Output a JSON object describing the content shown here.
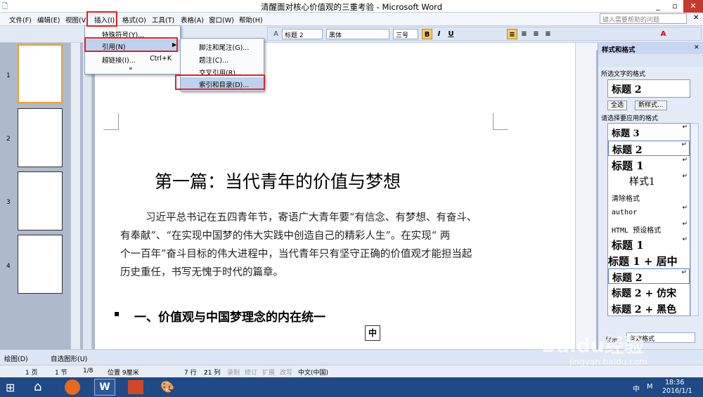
{
  "window": {
    "title": "清醒面对核心价值观的三重考验 - Microsoft Word",
    "min": "_",
    "max": "▫",
    "close": "✕"
  },
  "menu_bar": {
    "items": [
      "文件(F)",
      "编辑(E)",
      "视图(V)",
      "插入(I)",
      "格式(O)",
      "工具(T)",
      "表格(A)",
      "窗口(W)",
      "帮助(H)"
    ],
    "help_placeholder": "键入需要帮助的问题"
  },
  "formatting": {
    "style": "标题 2",
    "font": "黑体",
    "size": "三号",
    "bold": "B",
    "italic": "I",
    "underline": "U"
  },
  "insert_menu": {
    "items": [
      "特殊符号(Y)...",
      "引用(N)",
      "超链接(I)...",
      "Ctrl+K",
      "»"
    ]
  },
  "reference_submenu": {
    "items": [
      "脚注和尾注(G)...",
      "题注(C)...",
      "交叉引用(R)...",
      "索引和目录(D)..."
    ]
  },
  "document": {
    "heading1": "第一篇：当代青年的价值与梦想",
    "paragraph": "习近平总书记在五四青年节，寄语广大青年要“有信念、有梦想、有奋斗、有奉献”、“在实现中国梦的伟大实践中创造自己的精彩人生”。在实现“两个一百年”奋斗目标的伟大进程中，当代青年只有坚守正确的价值观才能担当起历史重任，书写无愧于时代的篇章。",
    "paragraph_lines": [
      "习近平总书记在五四青年节，寄语广大青年要“有信念、有梦想、有奋斗、",
      "有奉献”、“在实现中国梦的伟大实践中创造自己的精彩人生”。在实现“  两",
      "个一百年”奋斗目标的伟大进程中，当代青年只有坚守正确的价值观才能担当起",
      "历史重任，书写无愧于时代的篇章。"
    ],
    "heading2": "一、价值观与中国梦理念的内在统一",
    "ime_indicator": "中"
  },
  "thumbnails": [
    "1",
    "2",
    "3",
    "4"
  ],
  "styles_pane": {
    "title": "样式和格式",
    "selected_label": "所选文字的格式",
    "selected_style": "标题 2",
    "select_all": "全选",
    "new_style": "新样式...",
    "apply_label": "请选择要应用的格式",
    "list": [
      "标题 3",
      "标题 2",
      "标题 1",
      "样式1",
      "清除格式",
      "author",
      "HTML 预设格式",
      "标题 1",
      "标题 1 + 居中",
      "标题 2",
      "标题 2 + 仿宋",
      "标题 2 + 黑色"
    ],
    "show_label": "显示:",
    "show_value": "有效格式"
  },
  "drawing_bar": {
    "draw": "绘图(D)",
    "autoshapes": "自选图形(U)"
  },
  "status": {
    "page": "1 页",
    "section": "1 节",
    "pages": "1/8",
    "position": "位置 9厘米",
    "line": "7 行",
    "col": "21 列",
    "rec": "录制",
    "trk": "修订",
    "ext": "扩展",
    "ovr": "改写",
    "lang": "中文(中国)"
  },
  "taskbar": {
    "time": "18:36",
    "date": "2016/1/1",
    "ime": "中",
    "ime2": "M"
  },
  "watermark": {
    "brand": "Baidu经验",
    "url": "jingyan.baidu.com"
  },
  "colors": {
    "highlight": "#e31e24",
    "taskbar": "#1f4a86",
    "accent": "#f0a030"
  }
}
